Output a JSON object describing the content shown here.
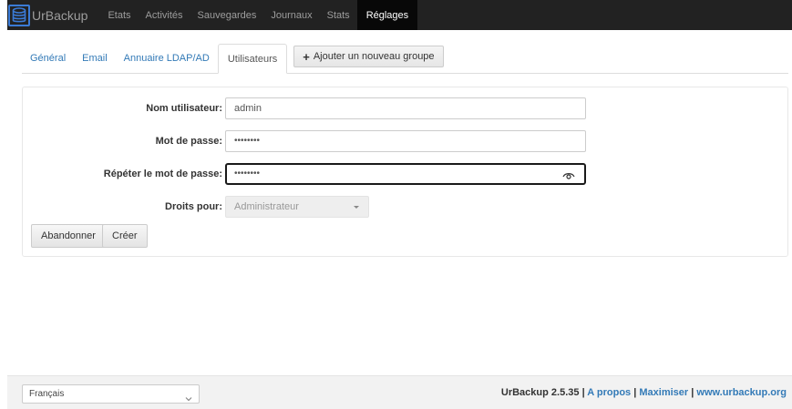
{
  "navbar": {
    "brand": "UrBackup",
    "items": [
      {
        "label": "Etats",
        "active": false
      },
      {
        "label": "Activités",
        "active": false
      },
      {
        "label": "Sauvegardes",
        "active": false
      },
      {
        "label": "Journaux",
        "active": false
      },
      {
        "label": "Stats",
        "active": false
      },
      {
        "label": "Réglages",
        "active": true
      }
    ]
  },
  "tabs": {
    "items": [
      {
        "label": "Général",
        "active": false
      },
      {
        "label": "Email",
        "active": false
      },
      {
        "label": "Annuaire LDAP/AD",
        "active": false
      },
      {
        "label": "Utilisateurs",
        "active": true
      }
    ],
    "add_group_label": "Ajouter un nouveau groupe"
  },
  "form": {
    "username_label": "Nom utilisateur:",
    "username_value": "admin",
    "password_label": "Mot de passe:",
    "password_value": "••••••••",
    "repeat_password_label": "Répéter le mot de passe:",
    "repeat_password_value": "••••••••",
    "rights_label": "Droits pour:",
    "rights_value": "Administrateur",
    "cancel_label": "Abandonner",
    "create_label": "Créer"
  },
  "footer": {
    "language": "Français",
    "version": "UrBackup 2.5.35",
    "sep": "|",
    "about": "A propos",
    "maximize": "Maximiser",
    "website": "www.urbackup.org"
  },
  "colors": {
    "navbar_bg": "#222222",
    "link": "#337ab7",
    "logo": "#3b7bd6"
  }
}
